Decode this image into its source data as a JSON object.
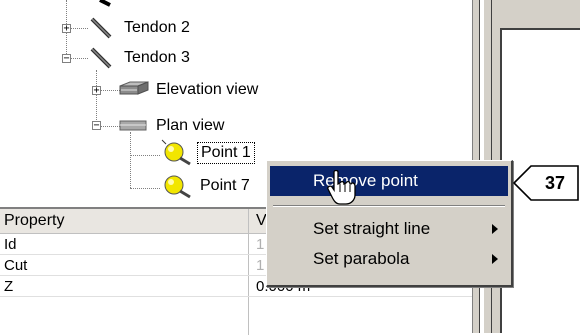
{
  "tree": {
    "items": [
      {
        "label": "Tendon 2",
        "expander": "+"
      },
      {
        "label": "Tendon 3",
        "expander": "−"
      },
      {
        "label": "Elevation view",
        "expander": "+"
      },
      {
        "label": "Plan view",
        "expander": "−"
      },
      {
        "label": "Point 1"
      },
      {
        "label": "Point 7"
      }
    ]
  },
  "grid": {
    "headers": {
      "property": "Property",
      "value": "V"
    },
    "rows": [
      {
        "name": "Id",
        "value": "1"
      },
      {
        "name": "Cut",
        "value": "1"
      },
      {
        "name": "Z",
        "value": "0.000 m"
      }
    ]
  },
  "context_menu": {
    "items": [
      {
        "label": "Remove point"
      },
      {
        "label": "Set straight line"
      },
      {
        "label": "Set parabola"
      }
    ]
  },
  "callout": {
    "number": "37"
  },
  "colors": {
    "menu_highlight": "#0a246a",
    "chrome": "#d4d0c8",
    "point_icon": "#f2e600"
  },
  "icons": [
    "tendon-icon",
    "elevation-view-icon",
    "plan-view-icon",
    "point-icon",
    "hand-cursor-icon"
  ]
}
